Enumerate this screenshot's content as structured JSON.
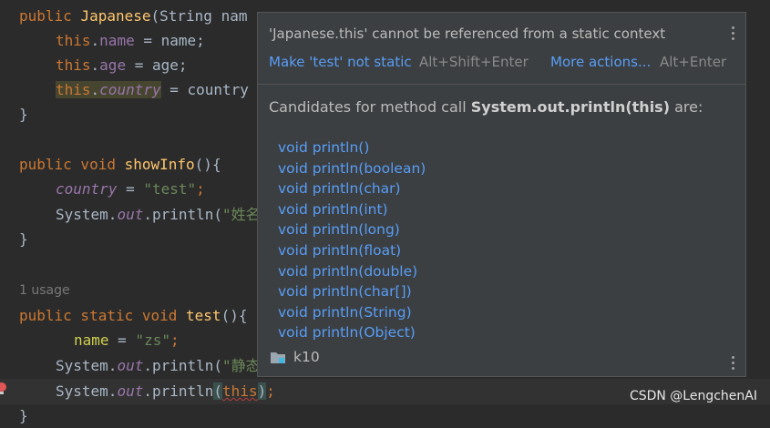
{
  "editor": {
    "l1_kw": "public",
    "l1_fn": "Japanese",
    "l1_rest": "(String nam",
    "l2_this": "this",
    "l2_field": "name",
    "l2_rest": " = name;",
    "l3_this": "this",
    "l3_field": "age",
    "l3_rest": " = age;",
    "l4_this": "this",
    "l4_field": "country",
    "l4_rest": " = country",
    "l5": "}",
    "l6_kw": "public void",
    "l6_fn": "showInfo",
    "l6_rest": "(){",
    "l7_field": "country",
    "l7_mid": " = ",
    "l7_str": "\"test\"",
    "l7_end": ";",
    "l8_a": "System.",
    "l8_out": "out",
    "l8_b": ".println(",
    "l8_str": "\"姓名",
    "l9": "}",
    "usage": "1 usage",
    "l10_kw": "public static void",
    "l10_fn": "test",
    "l10_rest": "(){",
    "l11_a": "name",
    "l11_b": " = ",
    "l11_str": "\"zs\"",
    "l11_end": ";",
    "l12_a": "System.",
    "l12_out": "out",
    "l12_b": ".println(",
    "l12_str": "\"静态",
    "l13_a": "System.",
    "l13_out": "out",
    "l13_b": ".println",
    "l13_paren_open": "(",
    "l13_this": "this",
    "l13_paren_close": ")",
    "l13_end": ";",
    "l14": "}"
  },
  "popup": {
    "error_message": "'Japanese.this' cannot be referenced from a static context",
    "quick_fix": "Make 'test' not static",
    "quick_fix_shortcut": "Alt+Shift+Enter",
    "more_actions": "More actions...",
    "more_actions_shortcut": "Alt+Enter",
    "candidates_prefix": "Candidates for method call ",
    "candidates_call": "System.out.println(this)",
    "candidates_suffix": " are:",
    "candidates": [
      "void println()",
      "void println(boolean)",
      "void println(char)",
      "void println(int)",
      "void println(long)",
      "void println(float)",
      "void println(double)",
      "void println(char[])",
      "void println(String)",
      "void println(Object)"
    ],
    "module": "k10"
  },
  "watermark": "CSDN @LengchenAI",
  "colors": {
    "editor_bg": "#2b2b2b",
    "popup_bg": "#3c3f41",
    "link": "#589df6",
    "keyword": "#cc7832",
    "method": "#ffc66d",
    "field": "#9876aa",
    "string": "#6a8759",
    "error": "#bc3f3c"
  }
}
